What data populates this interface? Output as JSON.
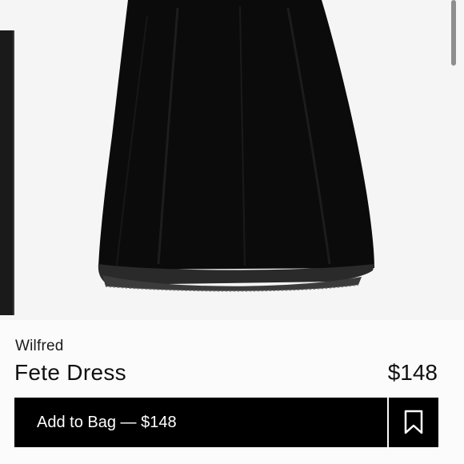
{
  "product": {
    "brand": "Wilfred",
    "name": "Fete Dress",
    "price": "$148"
  },
  "actions": {
    "add_to_bag_label": "Add to Bag — $148"
  },
  "icons": {
    "wishlist": "bookmark-icon"
  },
  "colors": {
    "button_bg": "#000000",
    "button_text": "#ffffff",
    "page_bg": "#f6f6f6"
  }
}
